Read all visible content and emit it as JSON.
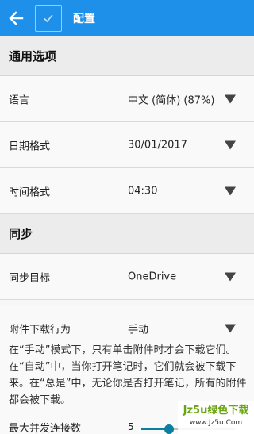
{
  "appbar": {
    "title": "配置"
  },
  "sections": {
    "general": "通用选项",
    "sync": "同步"
  },
  "general_rows": [
    {
      "label": "语言",
      "value": "中文 (简体) (87%)"
    },
    {
      "label": "日期格式",
      "value": "30/01/2017"
    },
    {
      "label": "时间格式",
      "value": "04:30"
    }
  ],
  "sync_rows": [
    {
      "label": "同步目标",
      "value": "OneDrive"
    }
  ],
  "attachment": {
    "label": "附件下载行为",
    "value": "手动",
    "description": "在“手动”模式下，只有单击附件时才会下载它们。在“自动”中，当你打开笔记时，它们就会被下载下来。在“总是”中，无论你是否打开笔记，所有的附件都会被下载。"
  },
  "concurrency": {
    "label": "最大并发连接数",
    "value": "5",
    "slider_fraction": 0.3
  },
  "watermark": {
    "main": "Jz5u绿色下载",
    "sub": "www.Jz5u.Com"
  },
  "colors": {
    "appbar": "#1e90ea",
    "slider": "#0b7fa0",
    "watermark": "#6aa510"
  }
}
